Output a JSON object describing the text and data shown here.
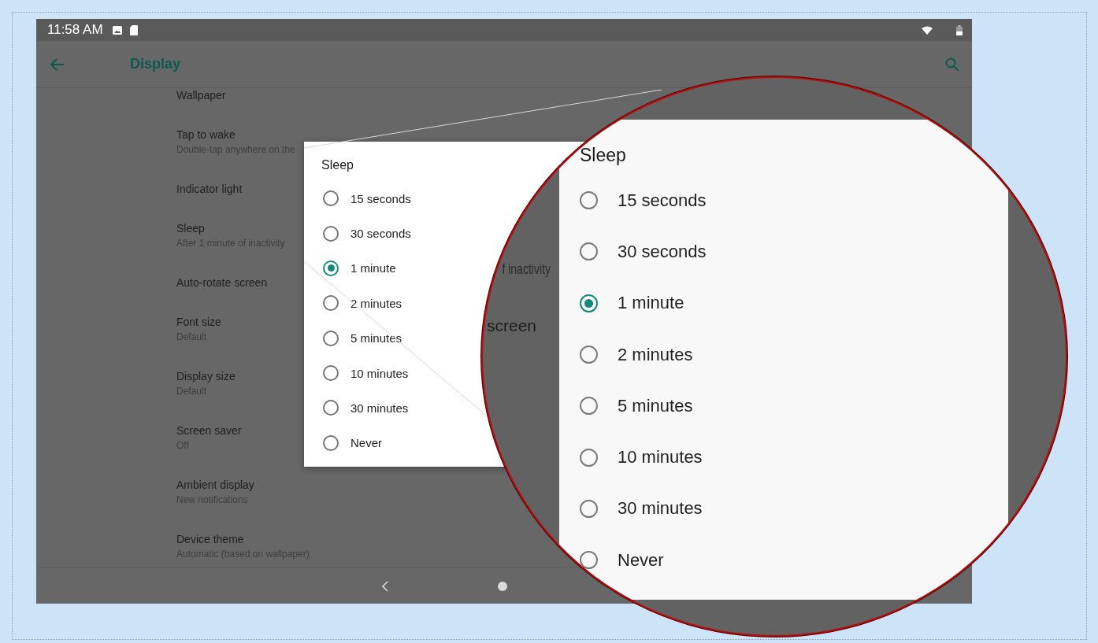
{
  "status_bar": {
    "time": "11:58 AM"
  },
  "app_bar": {
    "title": "Display"
  },
  "settings": [
    {
      "title": "Wallpaper"
    },
    {
      "title": "Tap to wake",
      "summary": "Double-tap anywhere on the"
    },
    {
      "title": "Indicator light"
    },
    {
      "title": "Sleep",
      "summary": "After 1 minute of inactivity"
    },
    {
      "title": "Auto-rotate screen"
    },
    {
      "title": "Font size",
      "summary": "Default"
    },
    {
      "title": "Display size",
      "summary": "Default"
    },
    {
      "title": "Screen saver",
      "summary": "Off"
    },
    {
      "title": "Ambient display",
      "summary": "New notifications"
    },
    {
      "title": "Device theme",
      "summary": "Automatic (based on wallpaper)"
    }
  ],
  "dialog": {
    "title": "Sleep",
    "options": [
      {
        "label": "15 seconds",
        "selected": false
      },
      {
        "label": "30 seconds",
        "selected": false
      },
      {
        "label": "1 minute",
        "selected": true
      },
      {
        "label": "2 minutes",
        "selected": false
      },
      {
        "label": "5 minutes",
        "selected": false
      },
      {
        "label": "10 minutes",
        "selected": false
      },
      {
        "label": "30 minutes",
        "selected": false
      },
      {
        "label": "Never",
        "selected": false
      }
    ]
  },
  "magnifier": {
    "background_texts": [
      "f inactivity",
      "screen"
    ],
    "dialog": {
      "title": "Sleep",
      "options": [
        {
          "label": "15 seconds",
          "selected": false
        },
        {
          "label": "30 seconds",
          "selected": false
        },
        {
          "label": "1 minute",
          "selected": true
        },
        {
          "label": "2 minutes",
          "selected": false
        },
        {
          "label": "5 minutes",
          "selected": false
        },
        {
          "label": "10 minutes",
          "selected": false
        },
        {
          "label": "30 minutes",
          "selected": false
        },
        {
          "label": "Never",
          "selected": false
        }
      ]
    }
  }
}
